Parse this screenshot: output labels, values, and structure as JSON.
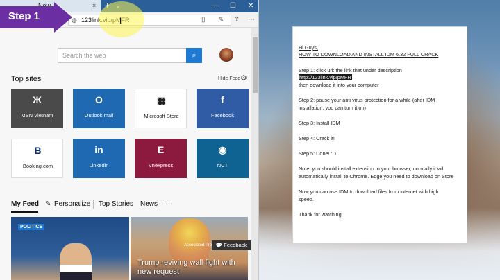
{
  "browser": {
    "tab": {
      "title": "New",
      "close": "×"
    },
    "new_tab": "+",
    "tab_dropdown": "⌄",
    "window": {
      "minimize": "—",
      "maximize": "☐",
      "close": "✕"
    },
    "address": {
      "value": "123link.vip/pMFR",
      "icon": "globe-icon"
    },
    "cursor": "I",
    "step_label": "Step 1",
    "search": {
      "placeholder": "Search the web",
      "button_icon": "search-icon"
    },
    "top_sites_title": "Top sites",
    "hide_feed": "Hide Feed",
    "tiles": [
      {
        "label": "MSN Vietnam",
        "icon": "Ж"
      },
      {
        "label": "Outlook mail",
        "icon": "O"
      },
      {
        "label": "Microsoft Store",
        "icon": "▦"
      },
      {
        "label": "Facebook",
        "icon": "f"
      },
      {
        "label": "Booking.com",
        "icon": "B"
      },
      {
        "label": "Linkedin",
        "icon": "in"
      },
      {
        "label": "Vnexpress",
        "icon": "E"
      },
      {
        "label": "NCT",
        "icon": "◉"
      }
    ],
    "feed_nav": {
      "my_feed": "My Feed",
      "personalize": "Personalize",
      "top_stories": "Top Stories",
      "news": "News",
      "more": "···"
    },
    "cards": {
      "politics_badge": "POLITICS",
      "headline": "Trump reviving wall fight with new request",
      "source": "Associated Press"
    },
    "feedback": "Feedback"
  },
  "notepad": {
    "lines": [
      "Hi Guys,",
      "HOW TO DOWNLOAD AND INSTALL IDM 6.32 FULL CRACK",
      "Step 1: click url: the link that under description",
      "http://123link.vip/pMFR",
      "then download it into your computer",
      "Step 2: pause your anti virus protection for a while (after IDM",
      "installation, you can turn it on)",
      "Step 3: Install IDM",
      "Step 4: Crack it!",
      "Step 5: Done! :D",
      "Note: you should install extension to your browser, normally it will",
      "automatically install to Chrome. Edge you need to download on Store",
      "Now you can use IDM to download files from internet with high",
      "speed.",
      "Thank for watching!"
    ]
  },
  "colors": {
    "step_badge": "#6b2ea3",
    "accent": "#1e79d3",
    "tabbar": "#2b5f97"
  }
}
